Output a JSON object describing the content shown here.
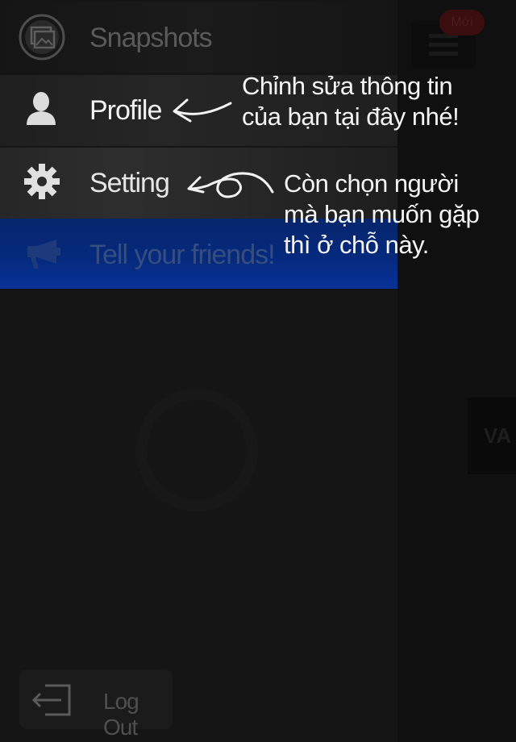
{
  "menu": {
    "items": [
      {
        "label": "Snapshots",
        "icon": "photos-icon"
      },
      {
        "label": "Profile",
        "icon": "user-icon"
      },
      {
        "label": "Setting",
        "icon": "gear-icon"
      },
      {
        "label": "Tell your friends!",
        "icon": "megaphone-icon"
      }
    ],
    "logout_label": "Log Out"
  },
  "tutorial": {
    "profile_hint_line1": "Chỉnh sửa thông tin",
    "profile_hint_line2": "của bạn tại đây nhé!",
    "setting_hint_line1": "Còn chọn người",
    "setting_hint_line2": "mà bạn muốn gặp",
    "setting_hint_line3": "thì ở chỗ này."
  },
  "background": {
    "badge": "Mới",
    "card_text": "VA"
  },
  "colors": {
    "accent_blue": "#052a7e",
    "overlay": "#141414",
    "text_active": "#f2f2f2"
  }
}
